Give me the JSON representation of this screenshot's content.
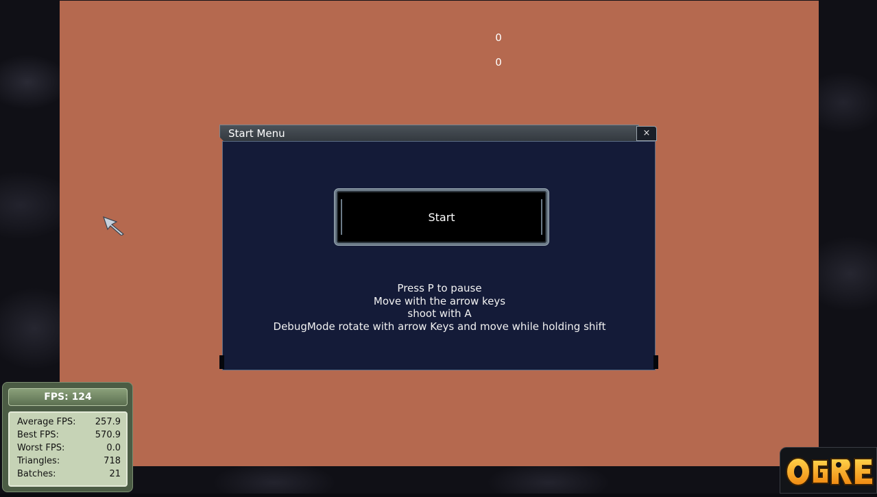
{
  "hud": {
    "score_top": "0",
    "score_bottom": "0"
  },
  "window": {
    "title": "Start Menu",
    "close_label": "×",
    "start_label": "Start",
    "instructions": [
      "Press P to pause",
      "Move with the arrow keys",
      "shoot with A",
      "DebugMode rotate with arrow Keys and move while holding shift"
    ]
  },
  "stats": {
    "fps_label": "FPS: 124",
    "rows": [
      {
        "label": "Average FPS:",
        "value": "257.9"
      },
      {
        "label": "Best FPS:",
        "value": "570.9"
      },
      {
        "label": "Worst FPS:",
        "value": "0.0"
      },
      {
        "label": "Triangles:",
        "value": "718"
      },
      {
        "label": "Batches:",
        "value": "21"
      }
    ]
  },
  "logo": {
    "icon": "ogre-logo",
    "text": "OGRE"
  },
  "colors": {
    "play_area": "#b5694f",
    "window_panel": "#141b38",
    "stats_panel": "#c6d3b6"
  }
}
